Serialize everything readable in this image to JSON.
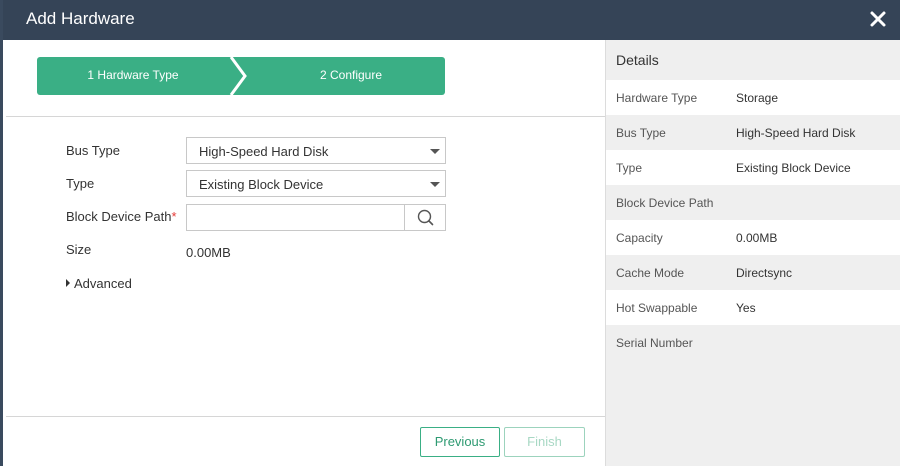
{
  "window": {
    "title": "Add Hardware"
  },
  "steps": [
    {
      "label": "1 Hardware Type"
    },
    {
      "label": "2 Configure"
    }
  ],
  "form": {
    "bus_type": {
      "label": "Bus Type",
      "value": "High-Speed Hard Disk"
    },
    "type": {
      "label": "Type",
      "value": "Existing Block Device"
    },
    "block_device_path": {
      "label": "Block Device Path",
      "required_marker": "*",
      "value": ""
    },
    "size": {
      "label": "Size",
      "value": "0.00MB"
    },
    "advanced_label": "Advanced"
  },
  "buttons": {
    "previous": "Previous",
    "finish": "Finish"
  },
  "details": {
    "title": "Details",
    "rows": [
      {
        "key": "Hardware Type",
        "value": "Storage"
      },
      {
        "key": "Bus Type",
        "value": "High-Speed Hard Disk"
      },
      {
        "key": "Type",
        "value": "Existing Block Device"
      },
      {
        "key": "Block Device Path",
        "value": ""
      },
      {
        "key": "Capacity",
        "value": "0.00MB"
      },
      {
        "key": "Cache Mode",
        "value": "Directsync"
      },
      {
        "key": "Hot Swappable",
        "value": "Yes"
      },
      {
        "key": "Serial Number",
        "value": ""
      }
    ]
  },
  "colors": {
    "titlebar": "#354457",
    "accent": "#3aaf85",
    "panel": "#efefef"
  },
  "icons": {
    "close": "close-icon",
    "search": "search-icon",
    "dropdown": "chevron-down-icon",
    "expand": "caret-right-icon"
  }
}
